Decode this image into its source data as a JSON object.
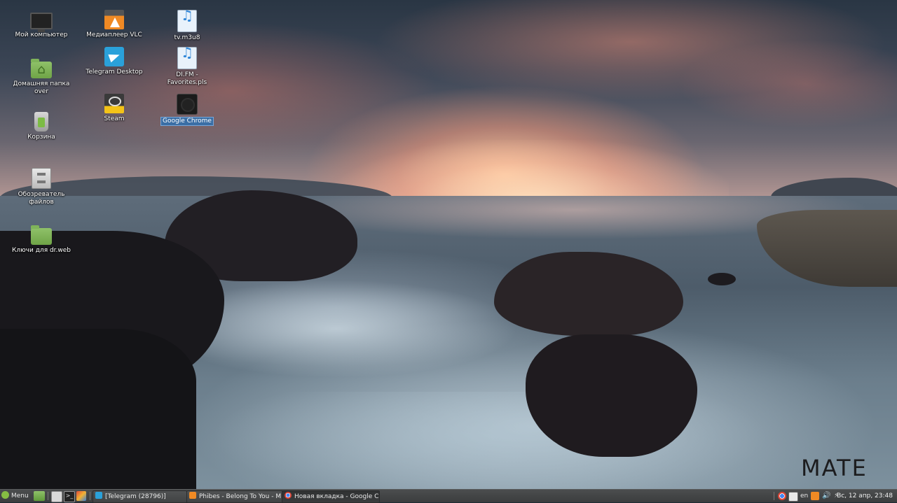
{
  "desktop": {
    "icons": [
      {
        "label": "Мой компьютер",
        "icon": "computer-icon"
      },
      {
        "label": "Домашняя папка over",
        "icon": "home-folder-icon"
      },
      {
        "label": "Корзина",
        "icon": "trash-icon"
      },
      {
        "label": "Обозреватель файлов",
        "icon": "file-cabinet-icon"
      },
      {
        "label": "Ключи для dr.web",
        "icon": "folder-icon"
      },
      {
        "label": "Медиаплеер VLC",
        "icon": "vlc-icon"
      },
      {
        "label": "Telegram Desktop",
        "icon": "telegram-icon"
      },
      {
        "label": "Steam",
        "icon": "steam-icon"
      },
      {
        "label": "tv.m3u8",
        "icon": "audio-playlist-icon"
      },
      {
        "label": "DI.FM - Favorites.pls",
        "icon": "audio-playlist-icon"
      },
      {
        "label": "Google Chrome",
        "icon": "chrome-icon",
        "selected": true
      }
    ],
    "watermark": "MATE"
  },
  "taskbar": {
    "menu_label": "Menu",
    "tasks": [
      {
        "label": "[Telegram (28796)]",
        "icon": "telegram-icon"
      },
      {
        "label": "Phibes - Belong To You - M...",
        "icon": "vlc-icon"
      },
      {
        "label": "Новая вкладка - Google C...",
        "icon": "chrome-icon",
        "active": true
      }
    ],
    "keyboard_layout": "en",
    "clock": "Вс, 12 апр, 23:48"
  },
  "colors": {
    "taskbar_bg": "#3f4142",
    "selection": "#3a6ea5",
    "mint_green": "#86be43"
  }
}
